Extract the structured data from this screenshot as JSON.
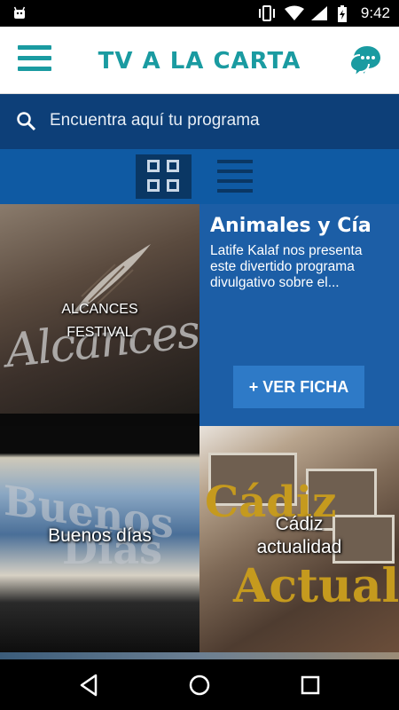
{
  "status_bar": {
    "time": "9:42"
  },
  "header": {
    "title": "TV A LA CARTA"
  },
  "search": {
    "placeholder": "Encuentra aquí tu programa"
  },
  "tiles": [
    {
      "label_line1": "ALCANCES",
      "label_line2": "FESTIVAL",
      "overlay_text": "Alcances"
    },
    {
      "title": "Animales y Cía",
      "description": "Latife Kalaf nos presenta este divertido programa divulgativo sobre el...",
      "button": "+ VER FICHA"
    },
    {
      "label": "Buenos días",
      "overlay_line1": "Buenos",
      "overlay_line2": "Días"
    },
    {
      "label_line1": "Cádiz",
      "label_line2": "actualidad",
      "overlay_c": "Cádiz",
      "overlay_a": "Actualidad"
    }
  ],
  "colors": {
    "accent": "#1a9ba1",
    "search_bg": "#0d3f78",
    "view_bar_bg": "#0f5aa3",
    "info_tile_bg": "#1c5ea6"
  }
}
